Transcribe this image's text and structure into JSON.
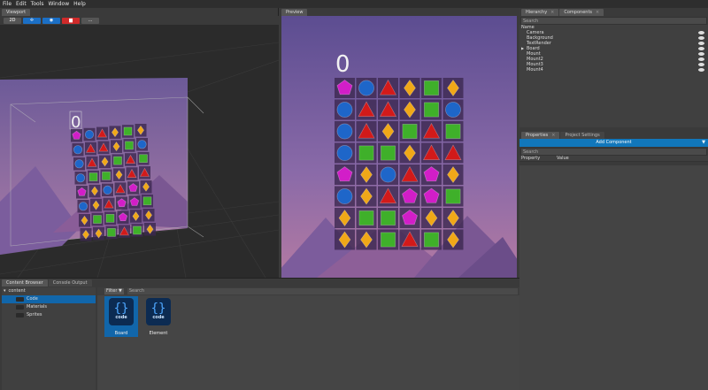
{
  "menu": [
    "File",
    "Edit",
    "Tools",
    "Window",
    "Help"
  ],
  "viewport": {
    "tab": "Viewport",
    "toolbar": [
      {
        "label": "2D",
        "color": "#555555"
      },
      {
        "label": "✢",
        "color": "#1b6fc5"
      },
      {
        "label": "◉",
        "color": "#1b6fc5"
      },
      {
        "label": "▆",
        "color": "#d02a2a"
      },
      {
        "label": "...",
        "color": "#555555"
      }
    ],
    "score": "0"
  },
  "preview": {
    "tab": "Preview",
    "score": "0"
  },
  "gem_grid": [
    [
      "pink",
      "blue",
      "red",
      "yellow",
      "green",
      "yellow"
    ],
    [
      "blue",
      "red",
      "red",
      "yellow",
      "green",
      "blue"
    ],
    [
      "blue",
      "red",
      "yellow",
      "green",
      "red",
      "green"
    ],
    [
      "blue",
      "green",
      "green",
      "yellow",
      "red",
      "red"
    ],
    [
      "pink",
      "yellow",
      "blue",
      "red",
      "pink",
      "yellow"
    ],
    [
      "blue",
      "yellow",
      "red",
      "pink",
      "pink",
      "green"
    ],
    [
      "yellow",
      "green",
      "green",
      "pink",
      "yellow",
      "yellow"
    ],
    [
      "yellow",
      "yellow",
      "green",
      "red",
      "green",
      "yellow"
    ]
  ],
  "colors": {
    "red": "#d21a1a",
    "blue": "#1e66c9",
    "yellow": "#f0a818",
    "green": "#3fb02a",
    "pink": "#d21ec8",
    "accent": "#1177bb",
    "selection": "#1166aa"
  },
  "hierarchy": {
    "tabs": [
      "Hierarchy",
      "Components"
    ],
    "search_placeholder": "Search",
    "header": "Name",
    "items": [
      {
        "name": "Camera",
        "arrow": ""
      },
      {
        "name": "Background",
        "arrow": ""
      },
      {
        "name": "TextRender",
        "arrow": ""
      },
      {
        "name": "Board",
        "arrow": "▶"
      },
      {
        "name": "Mount",
        "arrow": ""
      },
      {
        "name": "Mount2",
        "arrow": ""
      },
      {
        "name": "Mount3",
        "arrow": ""
      },
      {
        "name": "Mount4",
        "arrow": ""
      }
    ]
  },
  "properties": {
    "tabs": [
      "Properties",
      "Project Settings"
    ],
    "add_component": "Add Component",
    "search_placeholder": "Search",
    "col_property": "Property",
    "col_value": "Value"
  },
  "bottom": {
    "tabs": [
      "Content Browser",
      "Console Output"
    ],
    "tree": [
      {
        "name": "content",
        "level": 0,
        "selected": false
      },
      {
        "name": "Code",
        "level": 1,
        "selected": true
      },
      {
        "name": "Materials",
        "level": 1,
        "selected": false
      },
      {
        "name": "Sprites",
        "level": 1,
        "selected": false
      }
    ],
    "filter_label": "Filter",
    "search_placeholder": "Search",
    "files": [
      {
        "name": "Board",
        "icon_text": "code",
        "selected": true
      },
      {
        "name": "Element",
        "icon_text": "code",
        "selected": false
      }
    ]
  }
}
